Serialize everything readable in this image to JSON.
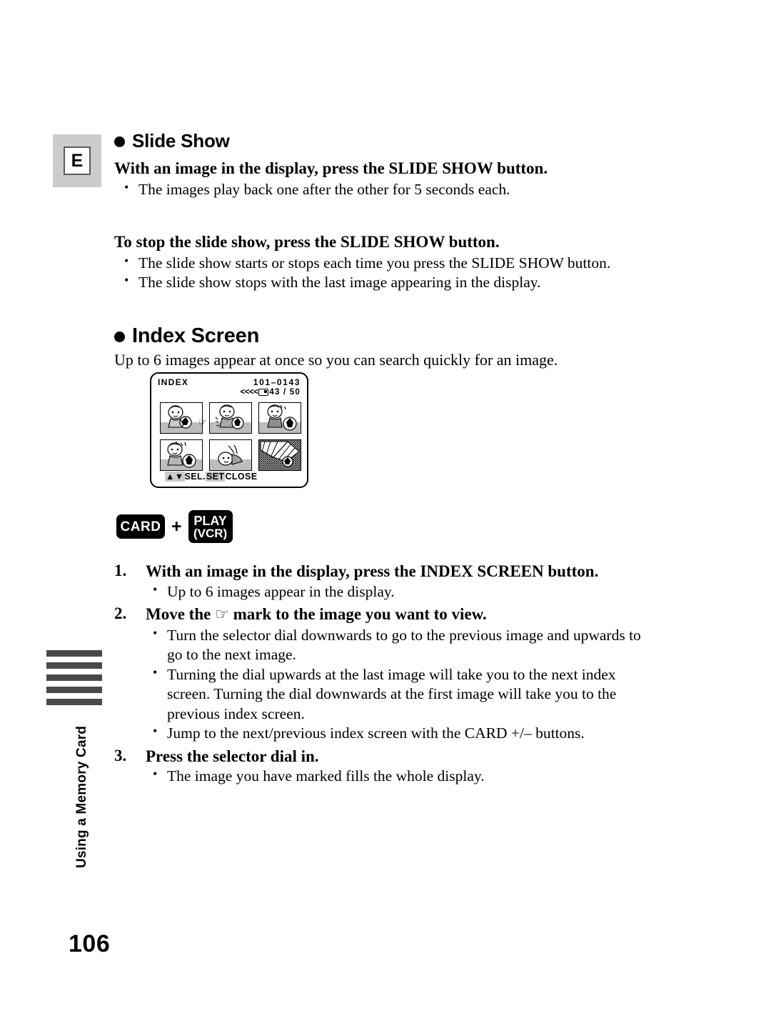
{
  "page": {
    "number": "106",
    "side_tab_label": "Using a Memory Card",
    "language_badge": "E"
  },
  "sections": [
    {
      "heading": "Slide Show",
      "bullet_icon": "filled-circle-icon",
      "blocks": [
        {
          "title": "With an image in the display, press the SLIDE SHOW button.",
          "bullets": [
            "The images play back one after the other for 5 seconds each."
          ]
        },
        {
          "title": "To stop the slide show, press the SLIDE SHOW button.",
          "bullets": [
            "The slide show starts or stops each time you press the SLIDE SHOW button.",
            "The slide show stops with the last image appearing in the display."
          ]
        }
      ]
    },
    {
      "heading": "Index Screen",
      "bullet_icon": "filled-circle-icon",
      "intro": "Up to 6 images appear at once so you can search quickly for an image."
    }
  ],
  "lcd": {
    "title": "INDEX",
    "file_number": "101–0143",
    "arrows": "<<<<",
    "card_icon": "memory-card-icon",
    "image_counter": "43 / 50",
    "pointer_mark": "☞",
    "footer": {
      "updown_arrows": "▲▼",
      "sel_label": "SEL",
      "separator": ".",
      "set_label": "SET",
      "close_label": "CLOSE"
    },
    "thumbnails": [
      {
        "id": 1,
        "kind": "baby-with-ball"
      },
      {
        "id": 2,
        "kind": "baby-with-ball"
      },
      {
        "id": 3,
        "kind": "baby-with-ball"
      },
      {
        "id": 4,
        "kind": "baby-with-ball"
      },
      {
        "id": 5,
        "kind": "baby-lying-down"
      },
      {
        "id": 6,
        "kind": "goal-net"
      }
    ]
  },
  "buttons": {
    "card_label": "CARD",
    "plus": "+",
    "play_label": "PLAY",
    "vcr_label": "(VCR)"
  },
  "steps": [
    {
      "number": "1.",
      "title": "With an image in the display, press the INDEX SCREEN button.",
      "bullets": [
        "Up to 6 images appear in the display."
      ]
    },
    {
      "number": "2.",
      "title_before": "Move the",
      "hand_glyph": "☞",
      "title_after": "mark to the image you want to view.",
      "bullets": [
        "Turn the selector dial downwards to go to the previous image and upwards to go to the next image.",
        "Turning the dial upwards at the last image will take you to the next index screen. Turning the dial downwards at the first image will take you to the previous index screen.",
        "Jump to the next/previous index screen with the CARD +/– buttons."
      ]
    },
    {
      "number": "3.",
      "title": "Press the selector dial in.",
      "bullets": [
        "The image you have marked fills the whole display."
      ]
    }
  ],
  "colors": {
    "badge_bg": "#cccccc",
    "side_bar": "#4a4a4a",
    "lcd_highlight": "#c9c9c9",
    "keycap_bg": "#000000"
  }
}
